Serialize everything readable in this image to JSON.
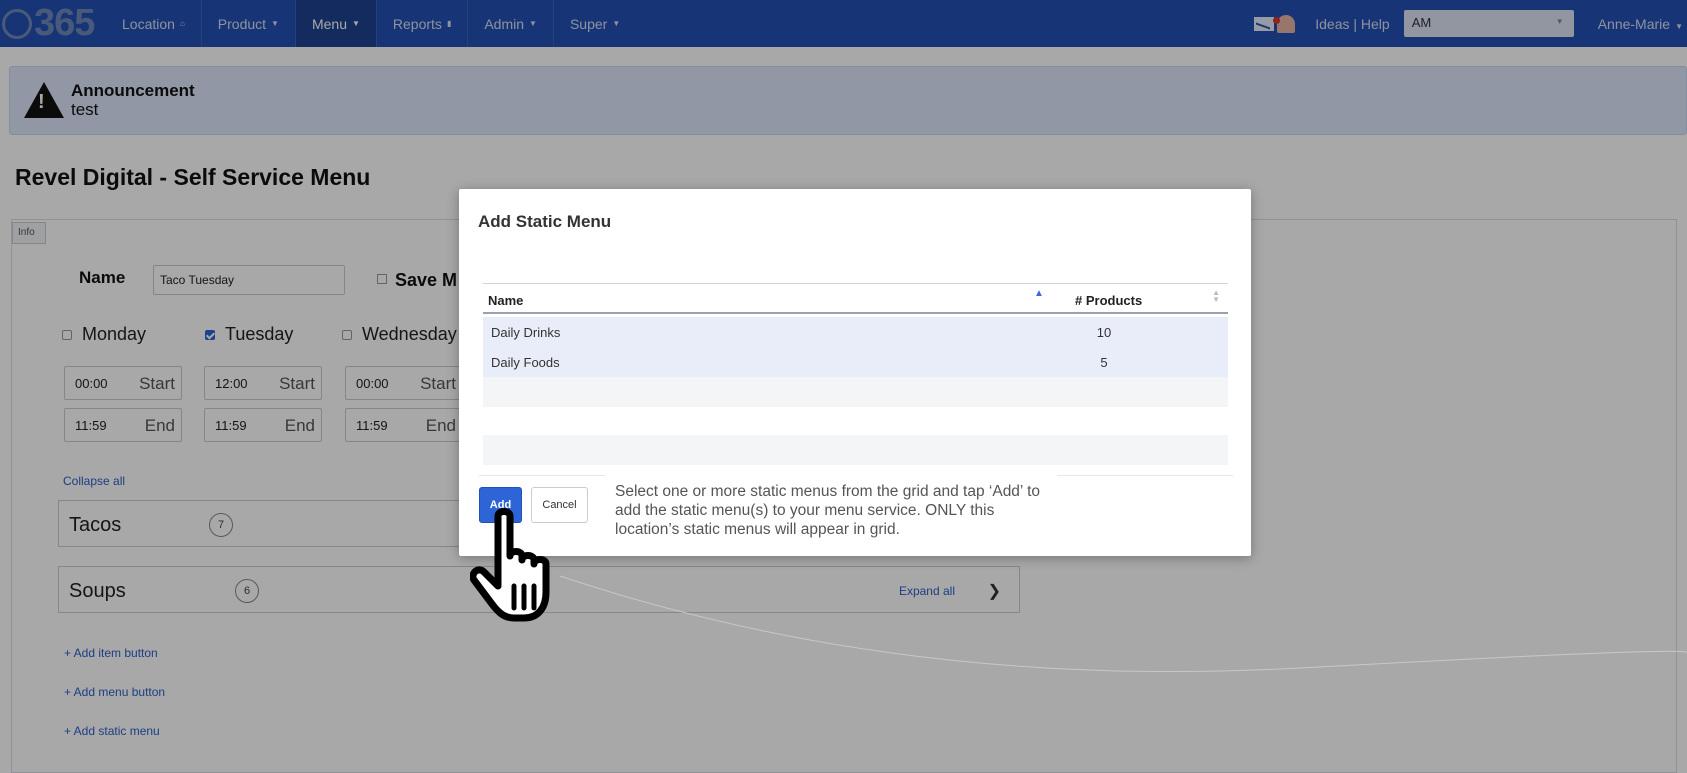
{
  "nav": {
    "logo": "365",
    "items": [
      {
        "label": "Location",
        "icon": "home-icon"
      },
      {
        "label": "Product"
      },
      {
        "label": "Menu"
      },
      {
        "label": "Reports",
        "icon": "bar-chart-icon"
      },
      {
        "label": "Admin"
      },
      {
        "label": "Super"
      }
    ],
    "ideas_help": "Ideas | Help",
    "account_select": "AM",
    "user": "Anne-Marie"
  },
  "announcement": {
    "title": "Announcement",
    "text": "test"
  },
  "page_title": "Revel Digital - Self Service Menu",
  "form": {
    "info_tab": "Info",
    "name_label": "Name",
    "name_value": "Taco Tuesday",
    "save_label": "Save M",
    "days": [
      {
        "label": "Monday",
        "checked": false,
        "start": "00:00",
        "end": "11:59"
      },
      {
        "label": "Tuesday",
        "checked": true,
        "start": "12:00",
        "end": "11:59"
      },
      {
        "label": "Wednesday",
        "checked": false,
        "start": "00:00",
        "end": "11:59"
      }
    ],
    "start_suffix": "Start",
    "end_suffix": "End",
    "collapse_all": "Collapse all",
    "groups": [
      {
        "label": "Tacos",
        "count": "7"
      },
      {
        "label": "Soups",
        "count": "6",
        "expand": "Expand all"
      }
    ],
    "links": [
      "+ Add item button",
      "+ Add menu button",
      "+ Add static menu"
    ]
  },
  "modal": {
    "title": "Add Static Menu",
    "columns": [
      "Name",
      "# Products"
    ],
    "rows": [
      {
        "name": "Daily Drinks",
        "products": "10"
      },
      {
        "name": "Daily Foods",
        "products": "5"
      }
    ],
    "add_label": "Add",
    "cancel_label": "Cancel",
    "help_text": "Select one or more static menus from the grid and tap ‘Add’ to add the static menu(s) to your menu service. ONLY this location’s static menus will appear in grid."
  },
  "colors": {
    "nav_bg": "#2351b3",
    "accent": "#2d64d6",
    "announcement_bg": "#dce6fb"
  }
}
